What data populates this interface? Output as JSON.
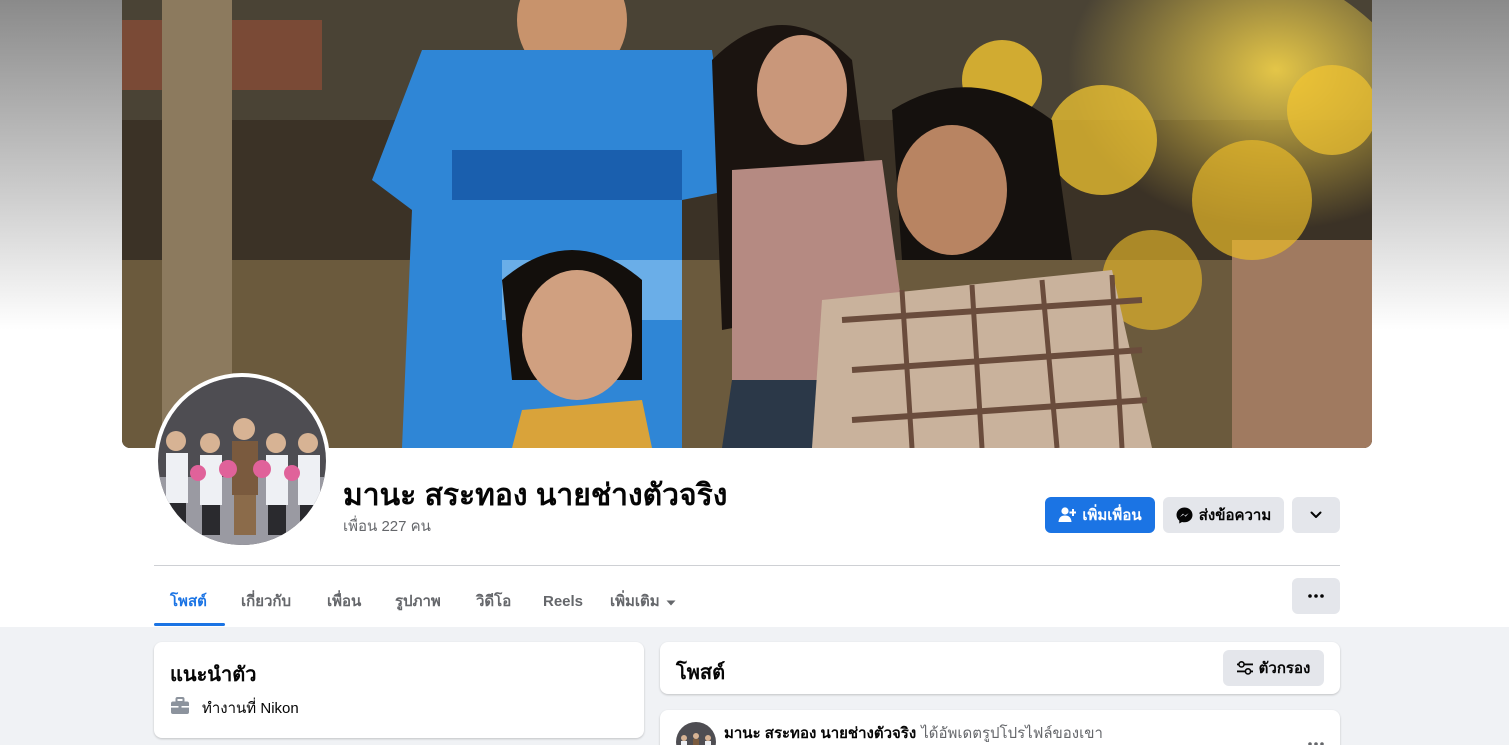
{
  "profile": {
    "name": "มานะ สระทอง นายช่างตัวจริง",
    "friends": "เพื่อน 227 คน"
  },
  "actions": {
    "add_friend": "เพิ่มเพื่อน",
    "message": "ส่งข้อความ"
  },
  "tabs": [
    "โพสต์",
    "เกี่ยวกับ",
    "เพื่อน",
    "รูปภาพ",
    "วิดีโอ",
    "Reels",
    "เพิ่มเติม"
  ],
  "intro": {
    "title": "แนะนำตัว",
    "work": "ทำงานที่ Nikon"
  },
  "posts": {
    "title": "โพสต์",
    "filter_label": "ตัวกรอง"
  },
  "first_post": {
    "author": "มานะ สระทอง นายช่างตัวจริง",
    "action": "ได้อัพเดตรูปโปรไฟล์ของเขา"
  },
  "colors": {
    "accent": "#1b74e4",
    "secondary_text": "#65676b",
    "button_gray": "#e4e6eb",
    "page_bg": "#f0f2f5"
  },
  "icons": {
    "add_friend": "person-plus-icon",
    "message": "messenger-icon",
    "dropdown": "chevron-down-icon",
    "more": "more-dots-icon",
    "filter": "sliders-icon",
    "work": "briefcase-icon"
  }
}
